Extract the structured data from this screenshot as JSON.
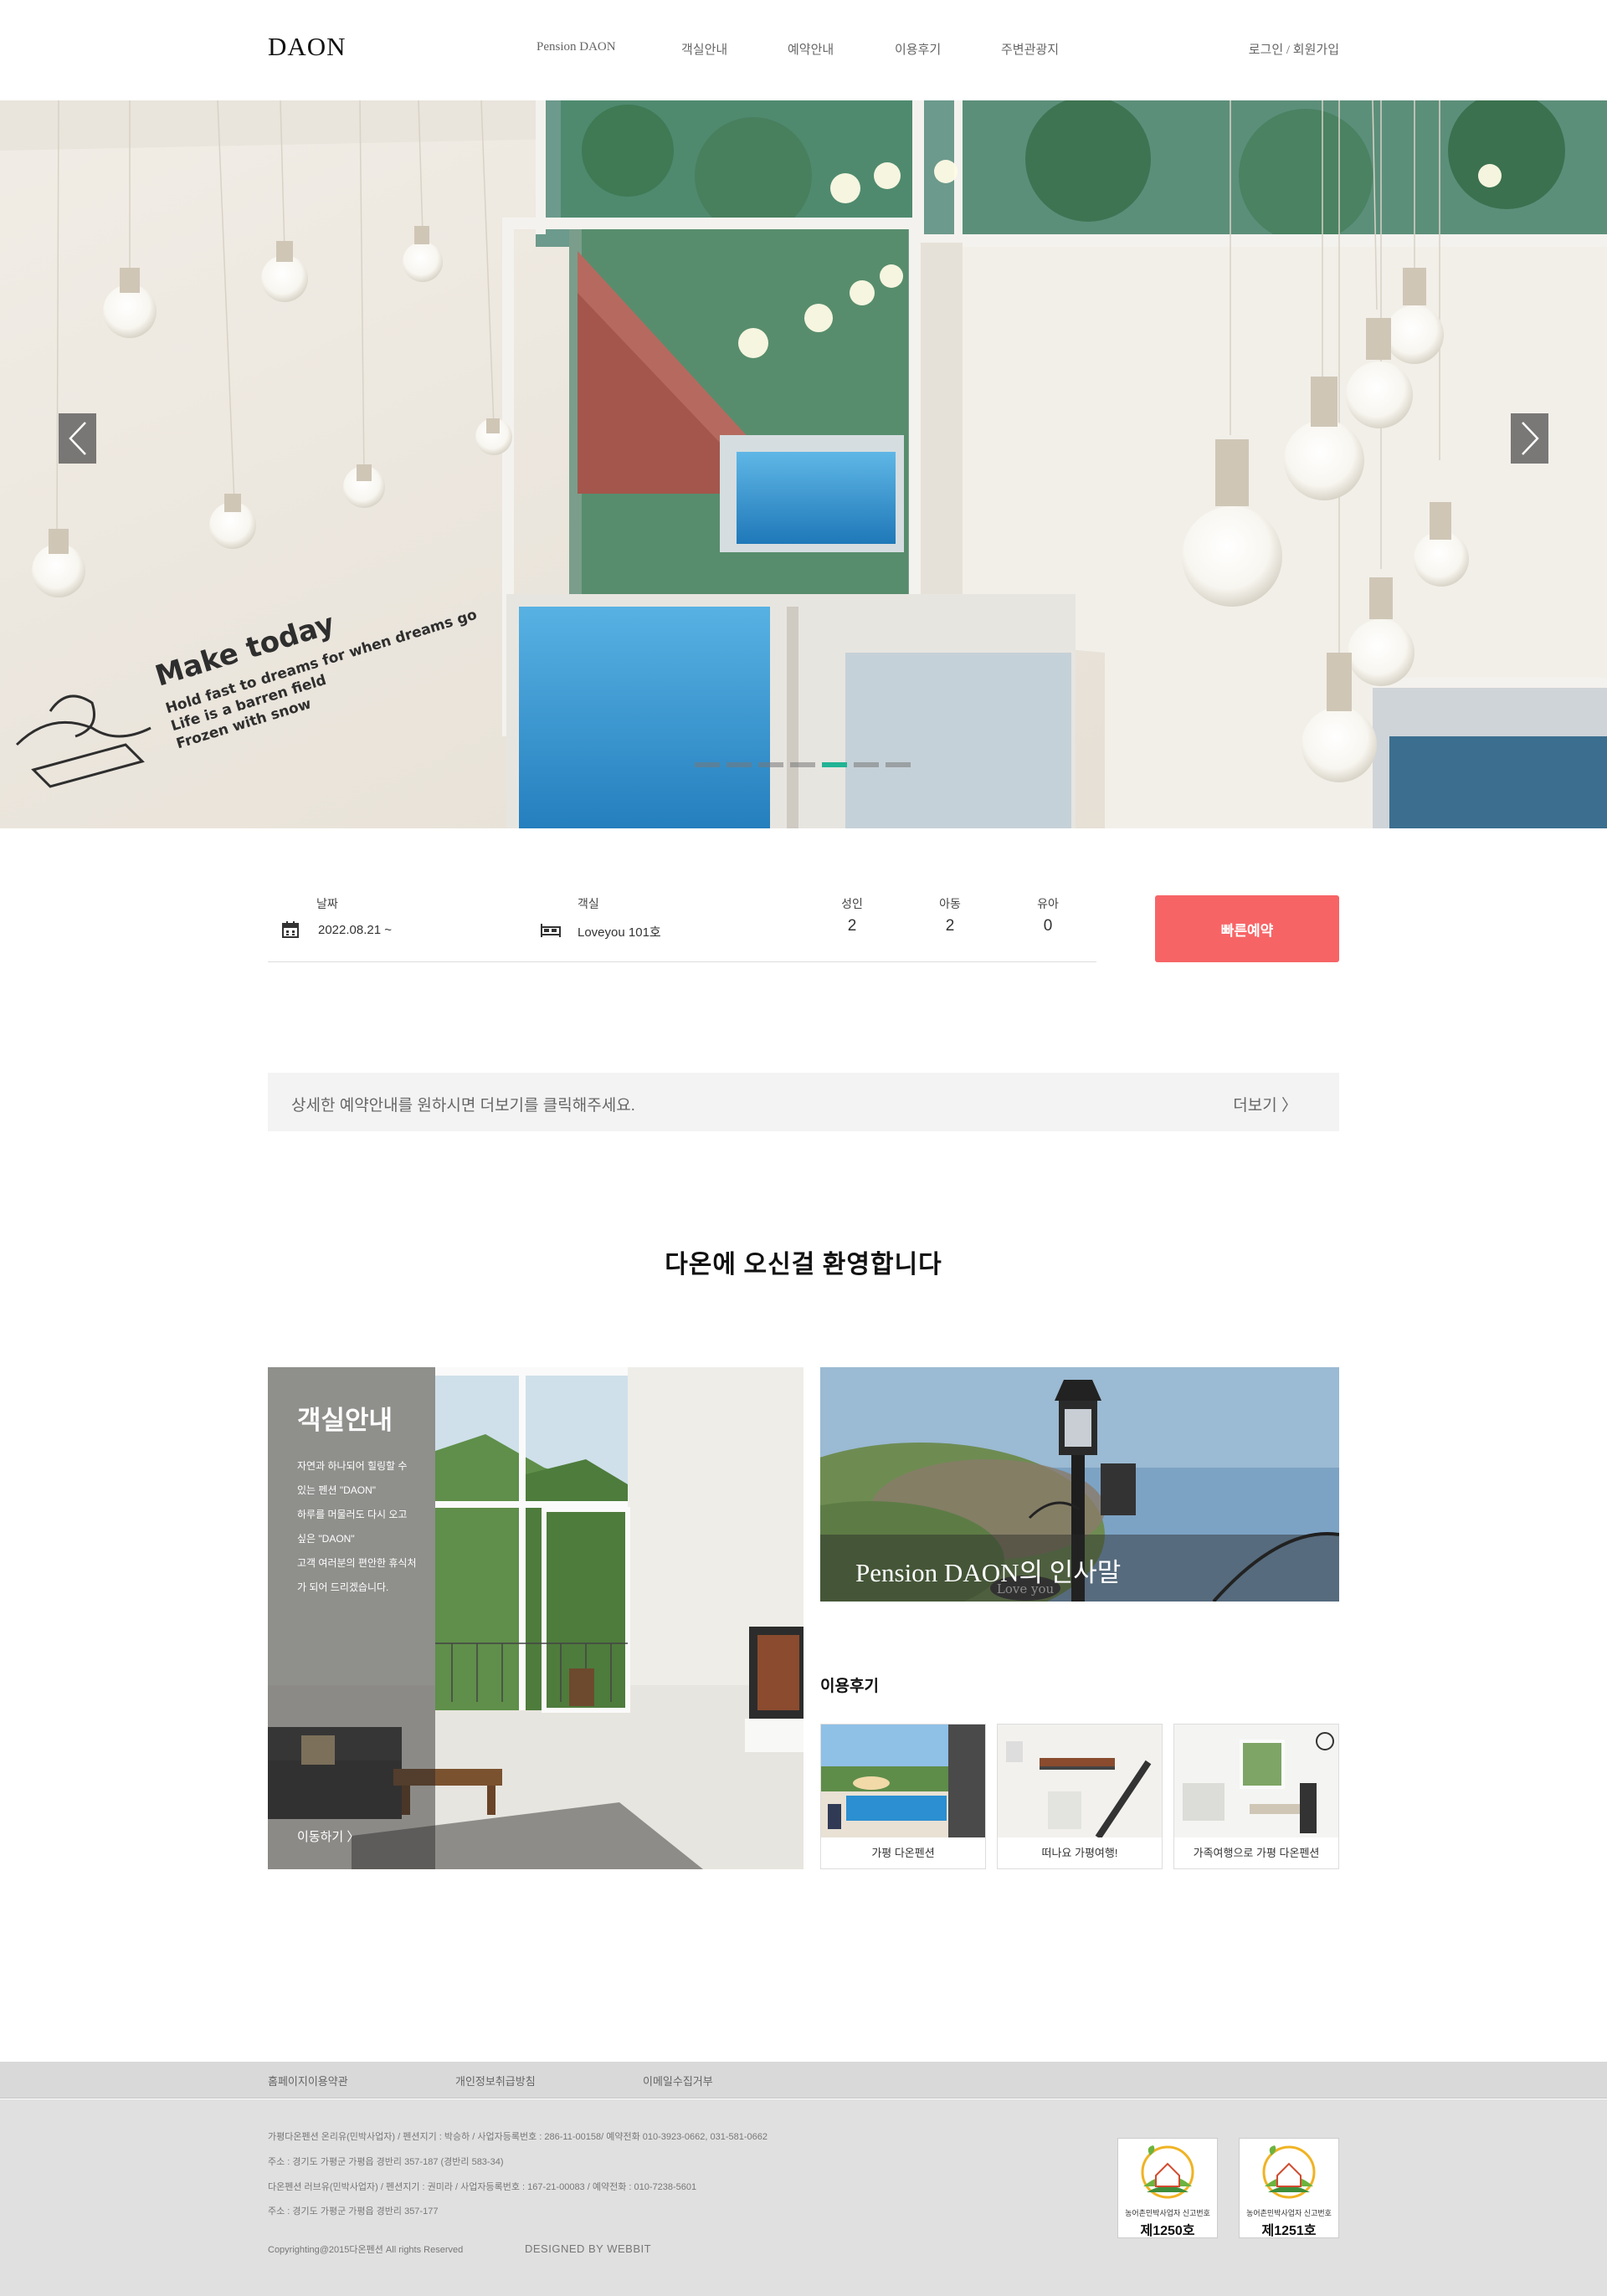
{
  "header": {
    "logo": "DAON",
    "nav": [
      "Pension DAON",
      "객실안내",
      "예약안내",
      "이용후기",
      "주변관광지"
    ],
    "login": "로그인",
    "separator": "/",
    "signup": "회원가입"
  },
  "hero": {
    "wall_text_title": "Make today",
    "wall_text_lines": [
      "Hold fast to dreams for when dreams go",
      "Life is a barren field",
      "Frozen with snow"
    ],
    "slides_total": 7,
    "active_slide": 5,
    "accent_color": "#23b394"
  },
  "booking": {
    "date_label": "날짜",
    "date_value": "2022.08.21 ~",
    "room_label": "객실",
    "room_value": "Loveyou 101호",
    "adult_label": "성인",
    "adult_value": "2",
    "child_label": "아동",
    "child_value": "2",
    "infant_label": "유아",
    "infant_value": "0",
    "quick_button": "빠른예약",
    "button_color": "#f76466"
  },
  "info": {
    "text": "상세한 예약안내를 원하시면 더보기를 클릭해주세요.",
    "more": "더보기 〉"
  },
  "welcome": "다온에 오신걸 환영합니다",
  "room_card": {
    "title": "객실안내",
    "desc_lines": [
      "자연과 하나되어 힐링할 수",
      "있는 펜션 \"DAON\"",
      "하루를 머물러도 다시 오고",
      "싶은 \"DAON\"",
      "고객 여러분의 편안한 휴식처",
      "가 되어 드리겠습니다."
    ],
    "link": "이동하기 〉"
  },
  "greeting_card": {
    "title": "Pension DAON의 인사말",
    "sign_text": "Love you"
  },
  "reviews": {
    "title": "이용후기",
    "items": [
      {
        "caption": "가평 다온펜션"
      },
      {
        "caption": "떠나요 가평여행!"
      },
      {
        "caption": "가족여행으로 가평 다온펜션"
      }
    ]
  },
  "footer": {
    "links": [
      "홈페이지이용약관",
      "개인정보취급방침",
      "이메일수집거부"
    ],
    "lines": [
      "가평다온펜션 온리유(민박사업자) / 펜션지기 : 박승하 / 사업자등록번호 : 286-11-00158/ 예약전화 010-3923-0662, 031-581-0662",
      "주소 : 경기도 가평군 가평읍 경반리 357-187 (경반리 583-34)",
      "다온펜션 러브유(민박사업자) / 펜션지기 : 권미라 / 사업자등록번호 : 167-21-00083 / 예약전화 : 010-7238-5601",
      "주소 : 경기도 가평군 가평읍 경반리 357-177"
    ],
    "copyright": "Copyrighting@2015다온펜션 All rights Reserved",
    "designer": "DESIGNED BY WEBBIT",
    "badges": [
      {
        "label": "농어촌민박사업자 신고번호",
        "number": "제1250호"
      },
      {
        "label": "농어촌민박사업자 신고번호",
        "number": "제1251호"
      }
    ]
  }
}
